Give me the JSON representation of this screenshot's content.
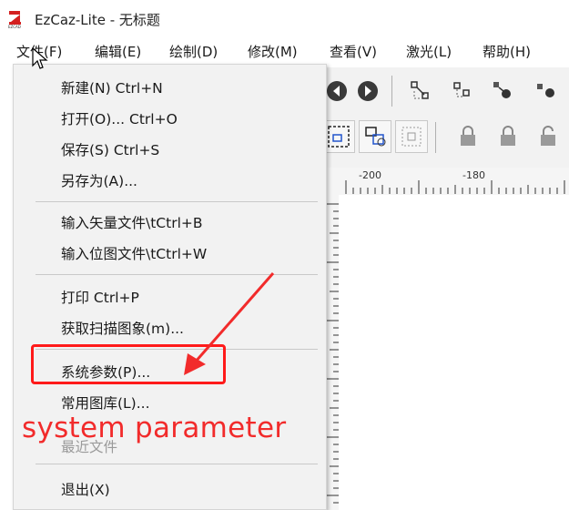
{
  "window": {
    "title": "EzCaz-Lite  - 无标题"
  },
  "menubar": [
    {
      "label": "文件(F)",
      "active": true
    },
    {
      "label": "编辑(E)"
    },
    {
      "label": "绘制(D)"
    },
    {
      "label": "修改(M)"
    },
    {
      "label": "查看(V)"
    },
    {
      "label": "激光(L)"
    },
    {
      "label": "帮助(H)"
    }
  ],
  "file_menu": {
    "items": [
      {
        "label": "新建(N) Ctrl+N"
      },
      {
        "label": "打开(O)... Ctrl+O"
      },
      {
        "label": "保存(S) Ctrl+S"
      },
      {
        "label": "另存为(A)..."
      },
      {
        "label": "输入矢量文件\\tCtrl+B"
      },
      {
        "label": "输入位图文件\\tCtrl+W"
      },
      {
        "label": "打印 Ctrl+P"
      },
      {
        "label": "获取扫描图象(m)..."
      },
      {
        "label": "系统参数(P)...",
        "highlighted": true
      },
      {
        "label": "常用图库(L)..."
      },
      {
        "label": "最近文件",
        "disabled": true
      },
      {
        "label": "退出(X)"
      }
    ]
  },
  "ruler": {
    "labels": [
      "-200",
      "-180"
    ]
  },
  "annotation": {
    "text": "system parameter",
    "color": "#f22b2b"
  },
  "icons": [
    "app-logo-icon",
    "mouse-pointer-icon",
    "nav-back-icon",
    "nav-forward-icon",
    "lock-icon"
  ]
}
